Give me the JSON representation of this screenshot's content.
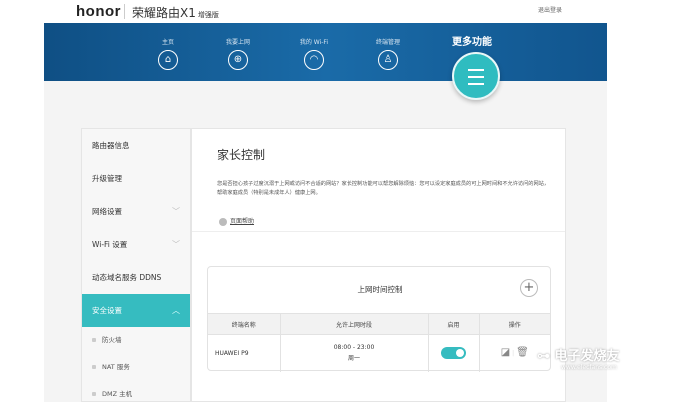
{
  "header": {
    "logo": "honor",
    "product": "荣耀路由X1",
    "edition": "增强版",
    "logout": "退出登录"
  },
  "nav": {
    "items": [
      {
        "label": "主页",
        "icon": "home-icon",
        "glyph": "⌂"
      },
      {
        "label": "我要上网",
        "icon": "globe-icon",
        "glyph": "⊕"
      },
      {
        "label": "我的 Wi-Fi",
        "icon": "wifi-icon",
        "glyph": "◠"
      },
      {
        "label": "终端管理",
        "icon": "user-icon",
        "glyph": "♙"
      }
    ],
    "more": "更多功能"
  },
  "sidebar": {
    "items": [
      {
        "label": "路由器信息"
      },
      {
        "label": "升级管理"
      },
      {
        "label": "网络设置",
        "chev": "﹀"
      },
      {
        "label": "Wi-Fi 设置",
        "chev": "﹀"
      },
      {
        "label": "动态域名服务 DDNS"
      },
      {
        "label": "安全设置",
        "chev": "︿"
      }
    ],
    "sub": [
      "防火墙",
      "NAT 服务",
      "DMZ 主机"
    ]
  },
  "main": {
    "title": "家长控制",
    "description": "您是否担心孩子过度沉溺于上网或访问不合适的网站？家长控制功能可以帮您解除烦恼：您可以设定家庭成员的可上网时间和不允许访问的网站，帮助家庭成员（特别是未成年人）健康上网。",
    "help": "页面帮助"
  },
  "card": {
    "title": "上网时间控制",
    "add": "+",
    "columns": [
      "终端名称",
      "允许上网时段",
      "启用",
      "操作"
    ],
    "rows": [
      {
        "device": "HUAWEI P9",
        "time": "08:00 - 23:00",
        "days": "周一",
        "enabled": true
      }
    ]
  },
  "colors": {
    "nav": "#1a6ba8",
    "accent": "#36bcc0"
  },
  "watermark": {
    "text": "电子发烧友",
    "url": "www.elecfans.com"
  }
}
